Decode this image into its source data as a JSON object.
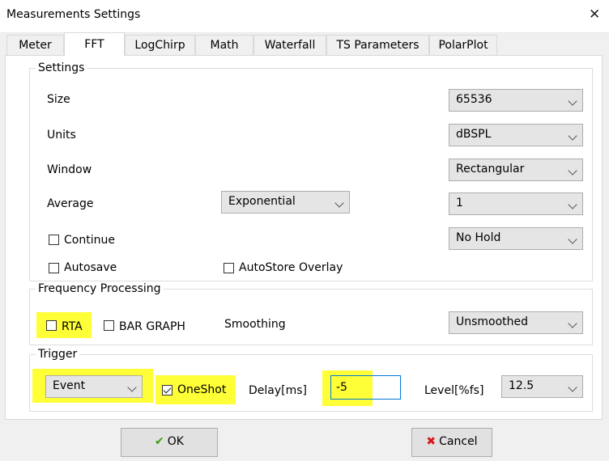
{
  "window": {
    "title": "Measurements Settings",
    "close_glyph": "✕"
  },
  "tabs": [
    {
      "label": "Meter"
    },
    {
      "label": "FFT"
    },
    {
      "label": "LogChirp"
    },
    {
      "label": "Math"
    },
    {
      "label": "Waterfall"
    },
    {
      "label": "TS Parameters"
    },
    {
      "label": "PolarPlot"
    }
  ],
  "active_tab": "FFT",
  "settings": {
    "legend": "Settings",
    "size_label": "Size",
    "size_value": "65536",
    "units_label": "Units",
    "units_value": "dBSPL",
    "window_label": "Window",
    "window_value": "Rectangular",
    "average_label": "Average",
    "average_mode_value": "Exponential",
    "average_count_value": "1",
    "continue_label": "Continue",
    "continue_checked": false,
    "hold_value": "No Hold",
    "autosave_label": "Autosave",
    "autosave_checked": false,
    "autostore_label": "AutoStore Overlay",
    "autostore_checked": false
  },
  "frequency_processing": {
    "legend": "Frequency Processing",
    "rta_label": "RTA",
    "rta_checked": false,
    "bargraph_label": "BAR GRAPH",
    "bargraph_checked": false,
    "smoothing_label": "Smoothing",
    "smoothing_value": "Unsmoothed"
  },
  "trigger": {
    "legend": "Trigger",
    "mode_value": "Event",
    "oneshot_label": "OneShot",
    "oneshot_checked": true,
    "delay_label": "Delay[ms]",
    "delay_value": "-5",
    "level_label": "Level[%fs]",
    "level_value": "12.5"
  },
  "buttons": {
    "ok_label": "OK",
    "cancel_label": "Cancel"
  },
  "highlight_color": "#ffff37",
  "icons": {
    "ok": "check-icon",
    "cancel": "x-icon",
    "dropdown": "chevron-down-icon"
  }
}
